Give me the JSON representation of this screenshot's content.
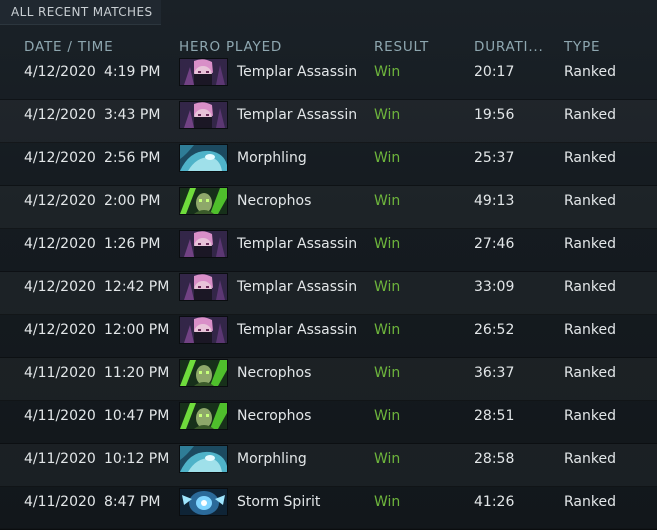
{
  "tab_label": "ALL RECENT MATCHES",
  "columns": {
    "date_time": "DATE / TIME",
    "hero": "HERO PLAYED",
    "result": "RESULT",
    "duration": "DURATI...",
    "type": "TYPE"
  },
  "rows": [
    {
      "date": "4/12/2020",
      "time": "4:19 PM",
      "hero": "Templar Assassin",
      "hero_icon": "templar-assassin-portrait",
      "result": "Win",
      "duration": "20:17",
      "type": "Ranked"
    },
    {
      "date": "4/12/2020",
      "time": "3:43 PM",
      "hero": "Templar Assassin",
      "hero_icon": "templar-assassin-portrait",
      "result": "Win",
      "duration": "19:56",
      "type": "Ranked"
    },
    {
      "date": "4/12/2020",
      "time": "2:56 PM",
      "hero": "Morphling",
      "hero_icon": "morphling-portrait",
      "result": "Win",
      "duration": "25:37",
      "type": "Ranked"
    },
    {
      "date": "4/12/2020",
      "time": "2:00 PM",
      "hero": "Necrophos",
      "hero_icon": "necrophos-portrait",
      "result": "Win",
      "duration": "49:13",
      "type": "Ranked"
    },
    {
      "date": "4/12/2020",
      "time": "1:26 PM",
      "hero": "Templar Assassin",
      "hero_icon": "templar-assassin-portrait",
      "result": "Win",
      "duration": "27:46",
      "type": "Ranked"
    },
    {
      "date": "4/12/2020",
      "time": "12:42 PM",
      "hero": "Templar Assassin",
      "hero_icon": "templar-assassin-portrait",
      "result": "Win",
      "duration": "33:09",
      "type": "Ranked"
    },
    {
      "date": "4/12/2020",
      "time": "12:00 PM",
      "hero": "Templar Assassin",
      "hero_icon": "templar-assassin-portrait",
      "result": "Win",
      "duration": "26:52",
      "type": "Ranked"
    },
    {
      "date": "4/11/2020",
      "time": "11:20 PM",
      "hero": "Necrophos",
      "hero_icon": "necrophos-portrait",
      "result": "Win",
      "duration": "36:37",
      "type": "Ranked"
    },
    {
      "date": "4/11/2020",
      "time": "10:47 PM",
      "hero": "Necrophos",
      "hero_icon": "necrophos-portrait",
      "result": "Win",
      "duration": "28:51",
      "type": "Ranked"
    },
    {
      "date": "4/11/2020",
      "time": "10:12 PM",
      "hero": "Morphling",
      "hero_icon": "morphling-portrait",
      "result": "Win",
      "duration": "28:58",
      "type": "Ranked"
    },
    {
      "date": "4/11/2020",
      "time": "8:47 PM",
      "hero": "Storm Spirit",
      "hero_icon": "storm-spirit-portrait",
      "result": "Win",
      "duration": "41:26",
      "type": "Ranked"
    }
  ],
  "colors": {
    "win": "#6db43c",
    "header": "#8ea7b0",
    "background": "#151b20"
  }
}
